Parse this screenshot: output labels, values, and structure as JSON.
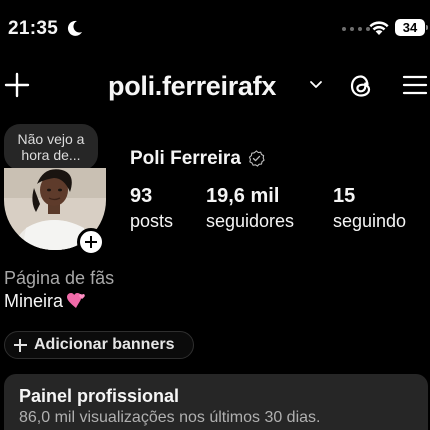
{
  "status_bar": {
    "time": "21:35",
    "battery": "34",
    "moon_icon": "moon-icon",
    "wifi_icon": "wifi-icon"
  },
  "header": {
    "username": "poli.ferreirafx",
    "new_post_icon": "plus-icon",
    "switch_icon": "chevron-down-icon",
    "threads_icon": "threads-icon",
    "menu_icon": "hamburger-menu-icon"
  },
  "profile": {
    "note": "Não vejo a hora de...",
    "full_name": "Poli Ferreira",
    "stats": [
      {
        "value": "93",
        "label": "posts"
      },
      {
        "value": "19,6 mil",
        "label": "seguidores"
      },
      {
        "value": "15",
        "label": "seguindo"
      }
    ],
    "category": "Página de fãs",
    "bio": "Mineira",
    "bio_emoji": "two-hearts-icon"
  },
  "actions": {
    "add_banners": "Adicionar banners"
  },
  "dashboard": {
    "title": "Painel profissional",
    "subtitle": "86,0 mil visualizações nos últimos 30 dias."
  },
  "colors": {
    "background": "#000000",
    "surface": "#262626",
    "text": "#f5f5f5",
    "muted": "#a8a8a8"
  }
}
